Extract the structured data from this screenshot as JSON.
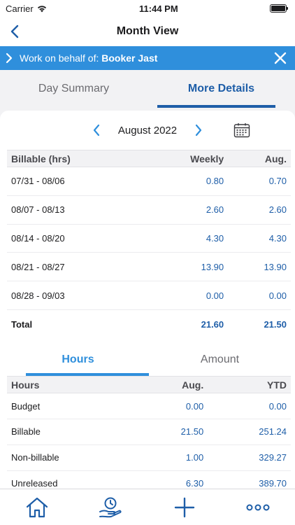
{
  "status": {
    "carrier": "Carrier",
    "time": "11:44 PM"
  },
  "nav": {
    "title": "Month View"
  },
  "behalf": {
    "prefix": "Work on behalf of:",
    "name": "Booker Jast"
  },
  "tabs": [
    {
      "label": "Day Summary"
    },
    {
      "label": "More Details"
    }
  ],
  "month": {
    "label": "August 2022"
  },
  "billable": {
    "headers": [
      "Billable (hrs)",
      "Weekly",
      "Aug."
    ],
    "rows": [
      {
        "range": "07/31 - 08/06",
        "weekly": "0.80",
        "month": "0.70"
      },
      {
        "range": "08/07 - 08/13",
        "weekly": "2.60",
        "month": "2.60"
      },
      {
        "range": "08/14 - 08/20",
        "weekly": "4.30",
        "month": "4.30"
      },
      {
        "range": "08/21 - 08/27",
        "weekly": "13.90",
        "month": "13.90"
      },
      {
        "range": "08/28 - 09/03",
        "weekly": "0.00",
        "month": "0.00"
      }
    ],
    "total": {
      "label": "Total",
      "weekly": "21.60",
      "month": "21.50"
    }
  },
  "subtabs": [
    {
      "label": "Hours"
    },
    {
      "label": "Amount"
    }
  ],
  "hours": {
    "headers": [
      "Hours",
      "Aug.",
      "YTD"
    ],
    "rows": [
      {
        "label": "Budget",
        "month": "0.00",
        "ytd": "0.00"
      },
      {
        "label": "Billable",
        "month": "21.50",
        "ytd": "251.24"
      },
      {
        "label": "Non-billable",
        "month": "1.00",
        "ytd": "329.27"
      },
      {
        "label": "Unreleased",
        "month": "6.30",
        "ytd": "389.70"
      }
    ]
  },
  "colors": {
    "accent": "#1e5ea8",
    "banner": "#2f8fdc"
  },
  "icons": {
    "home": "home-icon",
    "timer": "hand-clock-icon",
    "add": "plus-icon",
    "more": "more-icon"
  }
}
